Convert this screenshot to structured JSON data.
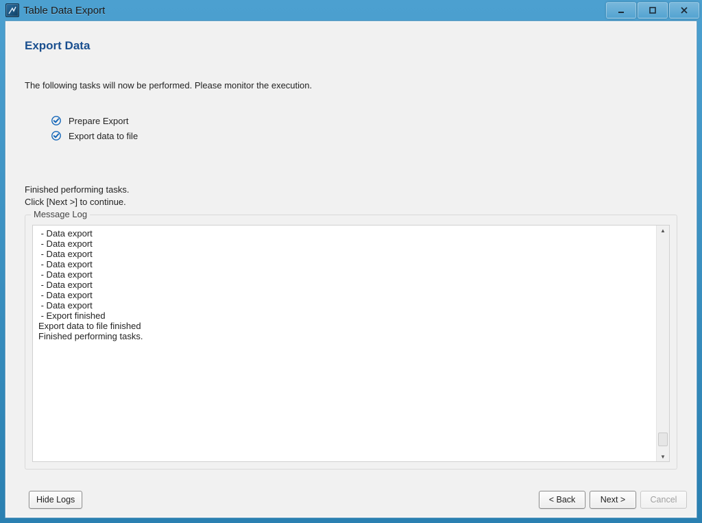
{
  "window": {
    "title": "Table Data Export"
  },
  "page": {
    "heading": "Export Data",
    "intro": "The following tasks will now be performed. Please monitor the execution."
  },
  "tasks": [
    {
      "label": "Prepare Export",
      "done": true
    },
    {
      "label": "Export data to file",
      "done": true
    }
  ],
  "status_line1": "Finished performing tasks.",
  "status_line2": "Click [Next >] to continue.",
  "log": {
    "title": "Message Log",
    "lines": [
      " - Data export",
      " - Data export",
      " - Data export",
      " - Data export",
      " - Data export",
      " - Data export",
      " - Data export",
      " - Data export",
      " - Export finished",
      "Export data to file finished",
      "Finished performing tasks."
    ]
  },
  "buttons": {
    "hide_logs": "Hide Logs",
    "back": "< Back",
    "next": "Next >",
    "cancel": "Cancel"
  }
}
